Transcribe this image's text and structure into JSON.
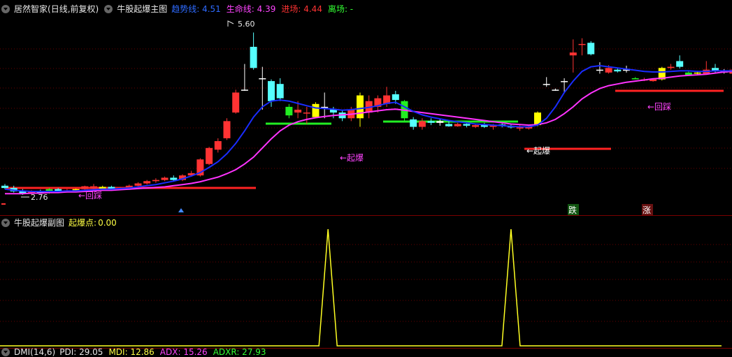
{
  "main_panel": {
    "app_name": "居然智家",
    "period": "(日线,前复权)",
    "indicator_name": "牛股起爆主图",
    "legend": [
      {
        "label": "趋势线:",
        "value": "4.51",
        "color": "#2e6bff"
      },
      {
        "label": "生命线:",
        "value": "4.39",
        "color": "#ff44ff"
      },
      {
        "label": "进场:",
        "value": "4.44",
        "color": "#ff3333"
      },
      {
        "label": "离场:",
        "value": "-",
        "color": "#33ff33"
      }
    ],
    "high_label": "5.60",
    "low_label": "2.76",
    "annotations": [
      "←回踩",
      "←起爆",
      "←起爆",
      "←回踩"
    ],
    "markers": [
      "跌",
      "涨"
    ]
  },
  "sub_panel": {
    "indicator_name": "牛股起爆副图",
    "legend_label": "起爆点:",
    "legend_value": "0.00"
  },
  "bottom_panel": {
    "indicator_name": "DMI(14,6)",
    "items": [
      {
        "label": "PDI:",
        "value": "29.05",
        "color": "#e8e8e8"
      },
      {
        "label": "MDI:",
        "value": "12.86",
        "color": "#ffff44"
      },
      {
        "label": "ADX:",
        "value": "15.26",
        "color": "#ff44ff"
      },
      {
        "label": "ADXR:",
        "value": "27.93",
        "color": "#33ff33"
      }
    ]
  },
  "chart_data": {
    "type": "candlestick",
    "candles": [
      {
        "o": 2.92,
        "h": 2.95,
        "l": 2.86,
        "c": 2.88,
        "t": "c"
      },
      {
        "o": 2.88,
        "h": 2.92,
        "l": 2.8,
        "c": 2.82,
        "t": "c"
      },
      {
        "o": 2.82,
        "h": 2.86,
        "l": 2.76,
        "c": 2.78,
        "t": "c"
      },
      {
        "o": 2.78,
        "h": 2.84,
        "l": 2.76,
        "c": 2.83,
        "t": "r"
      },
      {
        "o": 2.82,
        "h": 2.85,
        "l": 2.78,
        "c": 2.8,
        "t": "c"
      },
      {
        "o": 2.8,
        "h": 2.88,
        "l": 2.78,
        "c": 2.86,
        "t": "g"
      },
      {
        "o": 2.86,
        "h": 2.88,
        "l": 2.8,
        "c": 2.82,
        "t": "c"
      },
      {
        "o": 2.82,
        "h": 2.86,
        "l": 2.8,
        "c": 2.84,
        "t": "r"
      },
      {
        "o": 2.84,
        "h": 2.87,
        "l": 2.82,
        "c": 2.86,
        "t": "y"
      },
      {
        "o": 2.86,
        "h": 2.92,
        "l": 2.85,
        "c": 2.91,
        "t": "r"
      },
      {
        "o": 2.91,
        "h": 2.95,
        "l": 2.86,
        "c": 2.87,
        "t": "r"
      },
      {
        "o": 2.87,
        "h": 2.92,
        "l": 2.84,
        "c": 2.9,
        "t": "y"
      },
      {
        "o": 2.9,
        "h": 2.92,
        "l": 2.84,
        "c": 2.86,
        "t": "c"
      },
      {
        "o": 2.86,
        "h": 2.9,
        "l": 2.84,
        "c": 2.88,
        "t": "r"
      },
      {
        "o": 2.88,
        "h": 2.94,
        "l": 2.86,
        "c": 2.92,
        "t": "r"
      },
      {
        "o": 2.92,
        "h": 2.98,
        "l": 2.9,
        "c": 2.96,
        "t": "r"
      },
      {
        "o": 2.96,
        "h": 3.02,
        "l": 2.94,
        "c": 3.0,
        "t": "r"
      },
      {
        "o": 3.0,
        "h": 3.05,
        "l": 2.97,
        "c": 3.02,
        "t": "r"
      },
      {
        "o": 3.02,
        "h": 3.08,
        "l": 3.0,
        "c": 3.06,
        "t": "r"
      },
      {
        "o": 3.06,
        "h": 3.1,
        "l": 3.0,
        "c": 3.02,
        "t": "c"
      },
      {
        "o": 3.02,
        "h": 3.12,
        "l": 3.0,
        "c": 3.1,
        "t": "r"
      },
      {
        "o": 3.1,
        "h": 3.18,
        "l": 3.08,
        "c": 3.14,
        "t": "r"
      },
      {
        "o": 3.1,
        "h": 3.4,
        "l": 3.08,
        "c": 3.38,
        "t": "r"
      },
      {
        "o": 3.3,
        "h": 3.6,
        "l": 3.28,
        "c": 3.58,
        "t": "r"
      },
      {
        "o": 3.55,
        "h": 3.75,
        "l": 3.5,
        "c": 3.7,
        "t": "r"
      },
      {
        "o": 3.75,
        "h": 4.1,
        "l": 3.72,
        "c": 4.05,
        "t": "r"
      },
      {
        "o": 4.2,
        "h": 4.6,
        "l": 4.18,
        "c": 4.55,
        "t": "r"
      },
      {
        "o": 4.6,
        "h": 5.05,
        "l": 4.58,
        "c": 4.6,
        "t": "w"
      },
      {
        "o": 4.98,
        "h": 5.6,
        "l": 4.95,
        "c": 5.35,
        "t": "c"
      },
      {
        "o": 4.8,
        "h": 5.0,
        "l": 4.25,
        "c": 4.8,
        "t": "w"
      },
      {
        "o": 4.75,
        "h": 4.78,
        "l": 4.3,
        "c": 4.4,
        "t": "c"
      },
      {
        "o": 4.7,
        "h": 4.8,
        "l": 4.4,
        "c": 4.45,
        "t": "c"
      },
      {
        "o": 4.3,
        "h": 4.35,
        "l": 4.1,
        "c": 4.15,
        "t": "g"
      },
      {
        "o": 4.2,
        "h": 4.4,
        "l": 4.1,
        "c": 4.25,
        "t": "r"
      },
      {
        "o": 4.2,
        "h": 4.3,
        "l": 4.0,
        "c": 4.2,
        "t": "r"
      },
      {
        "o": 4.12,
        "h": 4.38,
        "l": 4.1,
        "c": 4.35,
        "t": "y"
      },
      {
        "o": 4.3,
        "h": 4.55,
        "l": 4.1,
        "c": 4.3,
        "t": "w"
      },
      {
        "o": 4.2,
        "h": 4.3,
        "l": 4.1,
        "c": 4.25,
        "t": "c"
      },
      {
        "o": 4.2,
        "h": 4.25,
        "l": 4.05,
        "c": 4.1,
        "t": "c"
      },
      {
        "o": 4.1,
        "h": 4.3,
        "l": 4.05,
        "c": 4.25,
        "t": "r"
      },
      {
        "o": 4.1,
        "h": 4.55,
        "l": 3.95,
        "c": 4.5,
        "t": "y"
      },
      {
        "o": 4.2,
        "h": 4.5,
        "l": 4.1,
        "c": 4.4,
        "t": "r"
      },
      {
        "o": 4.3,
        "h": 4.5,
        "l": 4.2,
        "c": 4.45,
        "t": "r"
      },
      {
        "o": 4.35,
        "h": 4.65,
        "l": 4.3,
        "c": 4.5,
        "t": "r"
      },
      {
        "o": 4.52,
        "h": 4.58,
        "l": 4.35,
        "c": 4.42,
        "t": "c"
      },
      {
        "o": 4.4,
        "h": 4.42,
        "l": 4.05,
        "c": 4.1,
        "t": "g"
      },
      {
        "o": 4.08,
        "h": 4.12,
        "l": 3.9,
        "c": 3.95,
        "t": "c"
      },
      {
        "o": 3.95,
        "h": 4.1,
        "l": 3.9,
        "c": 4.05,
        "t": "r"
      },
      {
        "o": 4.05,
        "h": 4.1,
        "l": 3.98,
        "c": 4.02,
        "t": "c"
      },
      {
        "o": 4.02,
        "h": 4.08,
        "l": 3.97,
        "c": 4.05,
        "t": "w"
      },
      {
        "o": 4.0,
        "h": 4.05,
        "l": 3.95,
        "c": 3.96,
        "t": "c"
      },
      {
        "o": 3.96,
        "h": 4.02,
        "l": 3.95,
        "c": 4.0,
        "t": "r"
      },
      {
        "o": 4.0,
        "h": 4.03,
        "l": 3.94,
        "c": 3.97,
        "t": "c"
      },
      {
        "o": 3.95,
        "h": 4.0,
        "l": 3.93,
        "c": 3.98,
        "t": "r"
      },
      {
        "o": 3.98,
        "h": 4.02,
        "l": 3.93,
        "c": 3.95,
        "t": "c"
      },
      {
        "o": 3.95,
        "h": 4.0,
        "l": 3.9,
        "c": 3.98,
        "t": "r"
      },
      {
        "o": 3.98,
        "h": 4.02,
        "l": 3.94,
        "c": 3.99,
        "t": "c"
      },
      {
        "o": 3.97,
        "h": 4.0,
        "l": 3.92,
        "c": 3.94,
        "t": "c"
      },
      {
        "o": 3.94,
        "h": 3.98,
        "l": 3.88,
        "c": 3.92,
        "t": "r"
      },
      {
        "o": 3.92,
        "h": 3.98,
        "l": 3.9,
        "c": 3.96,
        "t": "r"
      },
      {
        "o": 3.98,
        "h": 4.22,
        "l": 3.96,
        "c": 4.2,
        "t": "y"
      },
      {
        "o": 4.7,
        "h": 4.82,
        "l": 4.65,
        "c": 4.7,
        "t": "w"
      },
      {
        "o": 4.6,
        "h": 4.62,
        "l": 4.58,
        "c": 4.6,
        "t": "w"
      },
      {
        "o": 4.75,
        "h": 4.8,
        "l": 4.55,
        "c": 4.75,
        "t": "w"
      },
      {
        "o": 5.2,
        "h": 5.48,
        "l": 4.9,
        "c": 5.25,
        "t": "r"
      },
      {
        "o": 5.4,
        "h": 5.5,
        "l": 5.2,
        "c": 5.4,
        "t": "r"
      },
      {
        "o": 5.42,
        "h": 5.45,
        "l": 5.2,
        "c": 5.22,
        "t": "c"
      },
      {
        "o": 4.95,
        "h": 5.08,
        "l": 4.88,
        "c": 4.95,
        "t": "w"
      },
      {
        "o": 4.9,
        "h": 5.03,
        "l": 4.88,
        "c": 4.98,
        "t": "r"
      },
      {
        "o": 4.95,
        "h": 4.98,
        "l": 4.9,
        "c": 4.92,
        "t": "c"
      },
      {
        "o": 4.95,
        "h": 5.02,
        "l": 4.9,
        "c": 4.95,
        "t": "w"
      },
      {
        "o": 4.8,
        "h": 4.82,
        "l": 4.78,
        "c": 4.8,
        "t": "g"
      },
      {
        "o": 4.78,
        "h": 4.81,
        "l": 4.75,
        "c": 4.76,
        "t": "r"
      },
      {
        "o": 4.75,
        "h": 4.8,
        "l": 4.74,
        "c": 4.78,
        "t": "r"
      },
      {
        "o": 4.78,
        "h": 5.0,
        "l": 4.76,
        "c": 4.98,
        "t": "y"
      },
      {
        "o": 5.0,
        "h": 5.05,
        "l": 4.95,
        "c": 4.98,
        "t": "r"
      },
      {
        "o": 5.1,
        "h": 5.2,
        "l": 4.97,
        "c": 5.0,
        "t": "c"
      },
      {
        "o": 4.9,
        "h": 4.92,
        "l": 4.85,
        "c": 4.86,
        "t": "g"
      },
      {
        "o": 4.9,
        "h": 4.93,
        "l": 4.85,
        "c": 4.88,
        "t": "y"
      },
      {
        "o": 4.88,
        "h": 5.1,
        "l": 4.86,
        "c": 4.95,
        "t": "r"
      },
      {
        "o": 4.98,
        "h": 5.05,
        "l": 4.9,
        "c": 4.92,
        "t": "c"
      },
      {
        "o": 4.92,
        "h": 4.96,
        "l": 4.88,
        "c": 4.9,
        "t": "w"
      },
      {
        "o": 4.88,
        "h": 4.98,
        "l": 4.86,
        "c": 4.95,
        "t": "r"
      }
    ],
    "trend_line": [
      2.86,
      2.84,
      2.83,
      2.82,
      2.82,
      2.82,
      2.82,
      2.83,
      2.83,
      2.84,
      2.85,
      2.86,
      2.86,
      2.87,
      2.88,
      2.9,
      2.92,
      2.94,
      2.97,
      3.0,
      3.04,
      3.09,
      3.15,
      3.24,
      3.34,
      3.48,
      3.66,
      3.88,
      4.12,
      4.3,
      4.4,
      4.42,
      4.4,
      4.36,
      4.32,
      4.28,
      4.27,
      4.26,
      4.24,
      4.25,
      4.27,
      4.29,
      4.32,
      4.36,
      4.38,
      4.3,
      4.22,
      4.16,
      4.12,
      4.09,
      4.06,
      4.04,
      4.02,
      4.0,
      3.99,
      3.98,
      3.97,
      3.96,
      3.95,
      3.95,
      3.98,
      4.1,
      4.3,
      4.55,
      4.75,
      4.92,
      5.0,
      5.02,
      5.0,
      4.98,
      4.96,
      4.94,
      4.92,
      4.91,
      4.91,
      4.92,
      4.93,
      4.93,
      4.92,
      4.92,
      4.93,
      4.93,
      4.93
    ],
    "life_line": [
      2.78,
      2.78,
      2.78,
      2.79,
      2.79,
      2.8,
      2.8,
      2.81,
      2.81,
      2.82,
      2.83,
      2.84,
      2.84,
      2.85,
      2.86,
      2.87,
      2.88,
      2.89,
      2.9,
      2.92,
      2.94,
      2.96,
      2.99,
      3.03,
      3.07,
      3.13,
      3.2,
      3.3,
      3.42,
      3.58,
      3.74,
      3.88,
      3.98,
      4.04,
      4.08,
      4.11,
      4.13,
      4.15,
      4.16,
      4.17,
      4.19,
      4.21,
      4.23,
      4.25,
      4.26,
      4.24,
      4.22,
      4.2,
      4.18,
      4.16,
      4.14,
      4.12,
      4.1,
      4.08,
      4.06,
      4.04,
      4.02,
      4.0,
      3.99,
      3.98,
      3.99,
      4.02,
      4.08,
      4.18,
      4.3,
      4.44,
      4.54,
      4.62,
      4.67,
      4.7,
      4.73,
      4.75,
      4.77,
      4.79,
      4.8,
      4.82,
      4.84,
      4.85,
      4.86,
      4.87,
      4.89,
      4.91,
      4.92
    ],
    "ylim": [
      2.6,
      5.9
    ],
    "signal_spikes": [
      36,
      57
    ]
  }
}
